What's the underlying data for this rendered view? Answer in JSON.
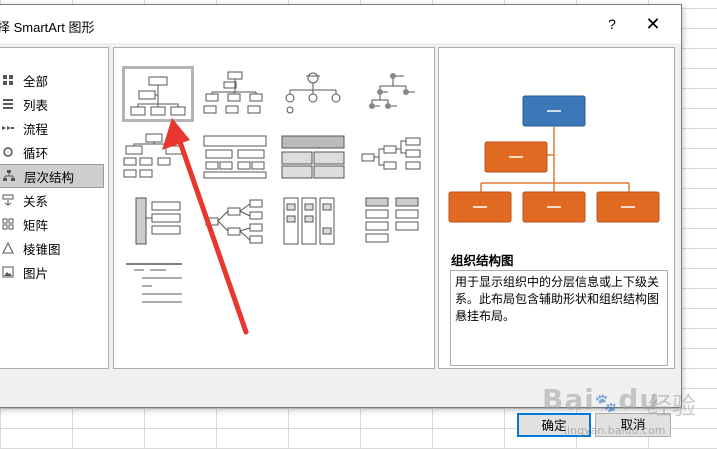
{
  "dialog": {
    "title": "择 SmartArt 图形",
    "help": "?",
    "close": "✕"
  },
  "categories": [
    {
      "label": "全部",
      "icon": "grid-icon"
    },
    {
      "label": "列表",
      "icon": "list-icon"
    },
    {
      "label": "流程",
      "icon": "process-icon"
    },
    {
      "label": "循环",
      "icon": "cycle-icon"
    },
    {
      "label": "层次结构",
      "icon": "hierarchy-icon",
      "selected": true
    },
    {
      "label": "关系",
      "icon": "relationship-icon"
    },
    {
      "label": "矩阵",
      "icon": "matrix-icon"
    },
    {
      "label": "棱锥图",
      "icon": "pyramid-icon"
    },
    {
      "label": "图片",
      "icon": "picture-icon"
    }
  ],
  "preview": {
    "title": "组织结构图",
    "description": "用于显示组织中的分层信息或上下级关系。此布局包含辅助形状和组织结构图悬挂布局。",
    "colors": {
      "top": "#3a78b8",
      "child": "#e06a22",
      "line": "#e07a3a"
    }
  },
  "buttons": {
    "ok": "确定",
    "cancel": "取消"
  },
  "watermark": {
    "logo": "Bai",
    "logo2": "du",
    "cn": "经验",
    "url": "jingyan.baidu.com"
  }
}
